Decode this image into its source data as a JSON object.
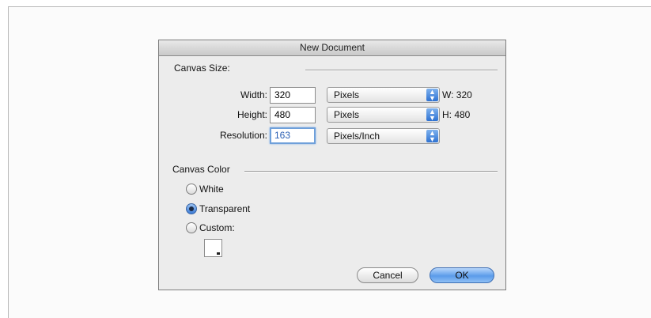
{
  "dialog": {
    "title": "New Document",
    "canvas_size": {
      "label": "Canvas Size:",
      "width": {
        "label": "Width:",
        "value": "320",
        "unit": "Pixels",
        "readout": "W: 320"
      },
      "height": {
        "label": "Height:",
        "value": "480",
        "unit": "Pixels",
        "readout": "H: 480"
      },
      "resolution": {
        "label": "Resolution:",
        "value": "163",
        "unit": "Pixels/Inch"
      }
    },
    "canvas_color": {
      "label": "Canvas Color",
      "options": [
        {
          "label": "White",
          "selected": false
        },
        {
          "label": "Transparent",
          "selected": true
        },
        {
          "label": "Custom:",
          "selected": false
        }
      ],
      "custom_swatch_color": "#ffffff"
    },
    "buttons": {
      "cancel": "Cancel",
      "ok": "OK"
    }
  },
  "colors": {
    "accent": "#3b7bd6",
    "dialog_bg": "#ececec"
  }
}
